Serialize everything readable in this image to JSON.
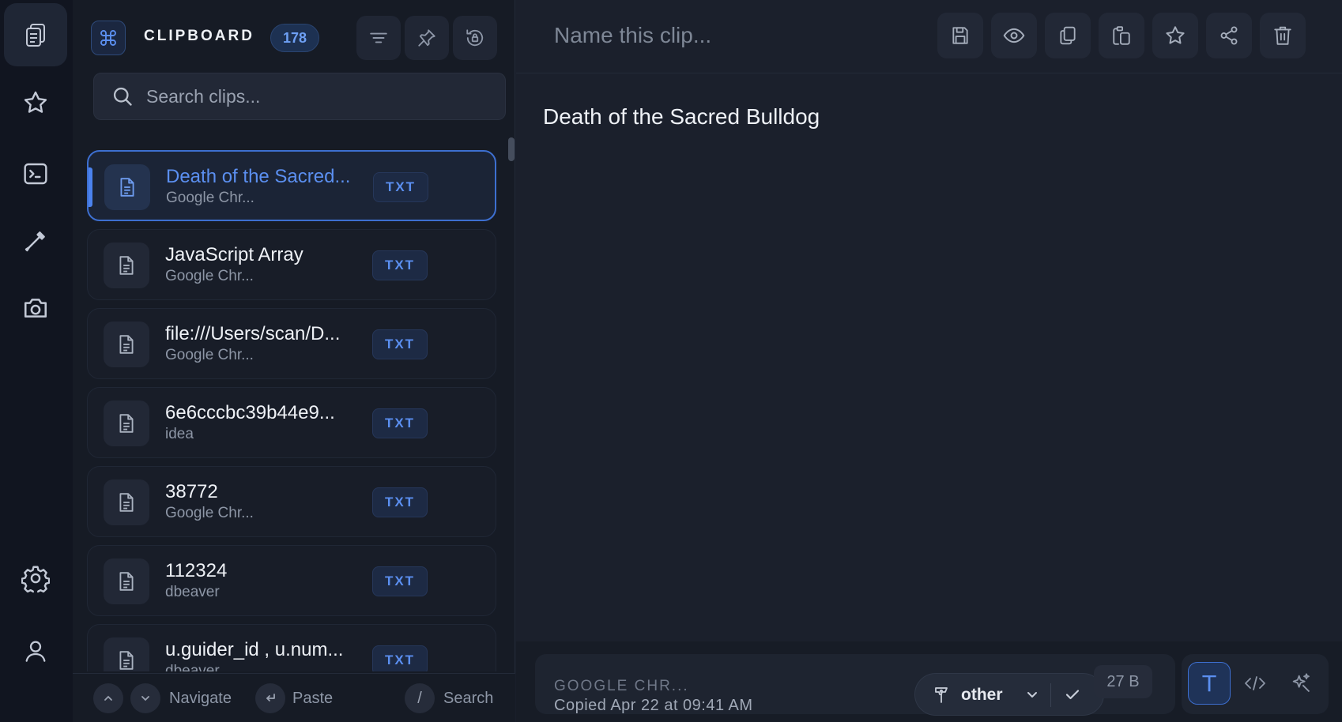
{
  "rail": {
    "items": [
      {
        "name": "clipboard-icon",
        "active": true
      },
      {
        "name": "star-icon"
      },
      {
        "name": "terminal-icon"
      },
      {
        "name": "eyedropper-icon"
      },
      {
        "name": "camera-icon"
      },
      {
        "name": "gear-icon"
      },
      {
        "name": "user-icon"
      }
    ]
  },
  "header": {
    "title": "CLIPBOARD",
    "count": "178",
    "icons": [
      "filter-icon",
      "pin-icon",
      "history-lock-icon"
    ]
  },
  "search": {
    "placeholder": "Search clips..."
  },
  "clips": [
    {
      "title": "Death of the Sacred...",
      "source": "Google Chr...",
      "type": "TXT",
      "selected": true
    },
    {
      "title": "JavaScript Array",
      "source": "Google Chr...",
      "type": "TXT"
    },
    {
      "title": "file:///Users/scan/D...",
      "source": "Google Chr...",
      "type": "TXT"
    },
    {
      "title": "6e6cccbc39b44e9...",
      "source": "idea",
      "type": "TXT"
    },
    {
      "title": "38772",
      "source": "Google Chr...",
      "type": "TXT"
    },
    {
      "title": "112324",
      "source": "dbeaver",
      "type": "TXT"
    },
    {
      "title": "u.guider_id , u.num...",
      "source": "dbeaver",
      "type": "TXT"
    }
  ],
  "footer": {
    "navigate_label": "Navigate",
    "paste_label": "Paste",
    "search_key": "/",
    "search_label": "Search"
  },
  "detail": {
    "name_placeholder": "Name this clip...",
    "toolbar_icons": [
      "save-icon",
      "eye-icon",
      "copy-icon",
      "paste-icon",
      "star-icon",
      "share-icon",
      "trash-icon"
    ],
    "content": "Death of the Sacred Bulldog",
    "source": "GOOGLE CHR...",
    "copied_at": "Copied Apr 22 at 09:41 AM",
    "category": "other",
    "size": "27 B",
    "mode_text_label": "T"
  },
  "colors": {
    "accent": "#4b82ee",
    "background": "#1a1f2b",
    "rail": "#111520"
  }
}
